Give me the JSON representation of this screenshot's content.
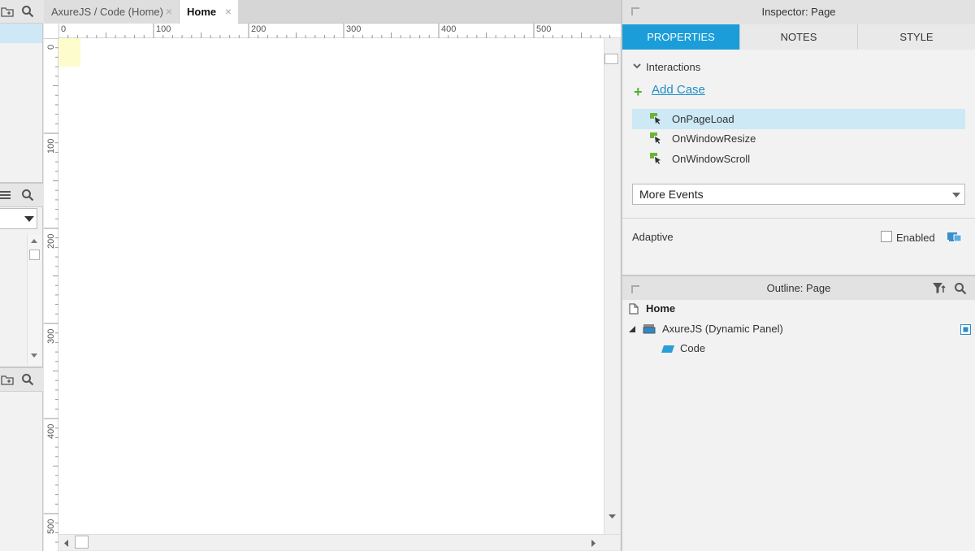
{
  "tabs": [
    {
      "label": "AxureJS / Code (Home)",
      "close": "×"
    },
    {
      "label": "Home",
      "close": "×"
    }
  ],
  "ruler": {
    "h": [
      "0",
      "100",
      "200",
      "300",
      "400",
      "500"
    ],
    "v": [
      "0",
      "100",
      "200",
      "300",
      "400",
      "500"
    ]
  },
  "inspector": {
    "title": "Inspector: Page",
    "tabs": [
      "PROPERTIES",
      "NOTES",
      "STYLE"
    ],
    "active_tab": "PROPERTIES",
    "interactions_label": "Interactions",
    "add_case_label": "Add Case",
    "events": [
      "OnPageLoad",
      "OnWindowResize",
      "OnWindowScroll"
    ],
    "selected_event": "OnPageLoad",
    "more_events_label": "More Events",
    "adaptive_label": "Adaptive",
    "enabled_label": "Enabled",
    "enabled_checked": false
  },
  "outline": {
    "title": "Outline: Page",
    "items": [
      {
        "label": "Home",
        "icon": "page-icon"
      },
      {
        "label": "AxureJS (Dynamic Panel)",
        "icon": "dynamic-panel-icon"
      },
      {
        "label": "Code",
        "icon": "shape-icon"
      }
    ]
  },
  "colors": {
    "accent": "#1a9dd9",
    "selection": "#cde9f6",
    "add_green": "#52b033",
    "link_blue": "#1e8fc8"
  }
}
